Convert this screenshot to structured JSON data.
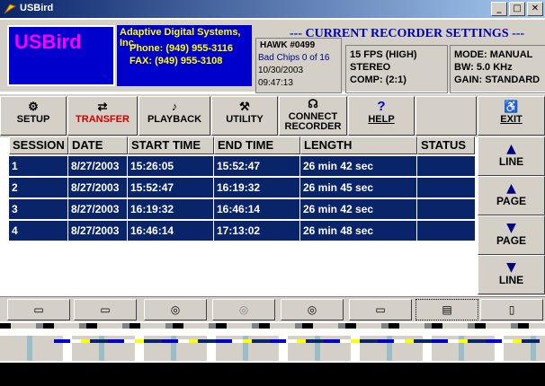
{
  "window": {
    "title": "USBird"
  },
  "header": {
    "brand": "USBird",
    "company_name": "Adaptive Digital Systems, Inc.",
    "phone": "Phone: (949) 955-3116",
    "fax": "FAX:    (949) 955-3108",
    "settings_title": "--- CURRENT RECORDER SETTINGS ---",
    "recorder": {
      "id": "HAWK #0499",
      "bad_chips": "Bad Chips 0 of 16",
      "date": "10/30/2003",
      "time": "09:47:13"
    },
    "settings": {
      "fps": "15 FPS (HIGH)",
      "channels": "STEREO",
      "comp": "COMP: (2:1)",
      "mode": "MODE: MANUAL",
      "bw": "BW: 5.0 KHz",
      "gain": "GAIN: STANDARD"
    },
    "colors": {
      "brand_bg": "#0000cc",
      "brand_text": "#ff00ff",
      "company_text": "#ffff00",
      "selected_row": "#0a246a",
      "transfer_label": "#cc0000"
    }
  },
  "toolbar": {
    "setup": {
      "label": "SETUP",
      "icon": "gear-icon"
    },
    "transfer": {
      "label": "TRANSFER",
      "icon": "transfer-icon"
    },
    "playback": {
      "label": "PLAYBACK",
      "icon": "speaker-icon"
    },
    "utility": {
      "label": "UTILITY",
      "icon": "wrench-icon"
    },
    "connect": {
      "label1": "CONNECT",
      "label2": "RECORDER",
      "icon": "connect-icon"
    },
    "help": {
      "label": "HELP",
      "icon": "help-icon"
    },
    "exit": {
      "label": "EXIT",
      "icon": "running-man-icon"
    }
  },
  "table": {
    "columns": [
      "SESSION",
      "DATE",
      "START TIME",
      "END TIME",
      "LENGTH",
      "STATUS"
    ],
    "rows": [
      {
        "session": "1",
        "date": "8/27/2003",
        "start": "15:26:05",
        "end": "15:52:47",
        "length": "26 min 42 sec",
        "status": ""
      },
      {
        "session": "2",
        "date": "8/27/2003",
        "start": "15:52:47",
        "end": "16:19:32",
        "length": "26 min 45 sec",
        "status": ""
      },
      {
        "session": "3",
        "date": "8/27/2003",
        "start": "16:19:32",
        "end": "16:46:14",
        "length": "26 min 42 sec",
        "status": ""
      },
      {
        "session": "4",
        "date": "8/27/2003",
        "start": "16:46:14",
        "end": "17:13:02",
        "length": "26 min 48 sec",
        "status": ""
      }
    ]
  },
  "sidebar": {
    "line_up": {
      "label": "LINE",
      "icon": "arrow-up-icon"
    },
    "page_up": {
      "label": "PAGE",
      "icon": "arrow-up-icon"
    },
    "page_down": {
      "label": "PAGE",
      "icon": "arrow-down-icon"
    },
    "line_down": {
      "label": "LINE",
      "icon": "arrow-down-icon"
    }
  }
}
